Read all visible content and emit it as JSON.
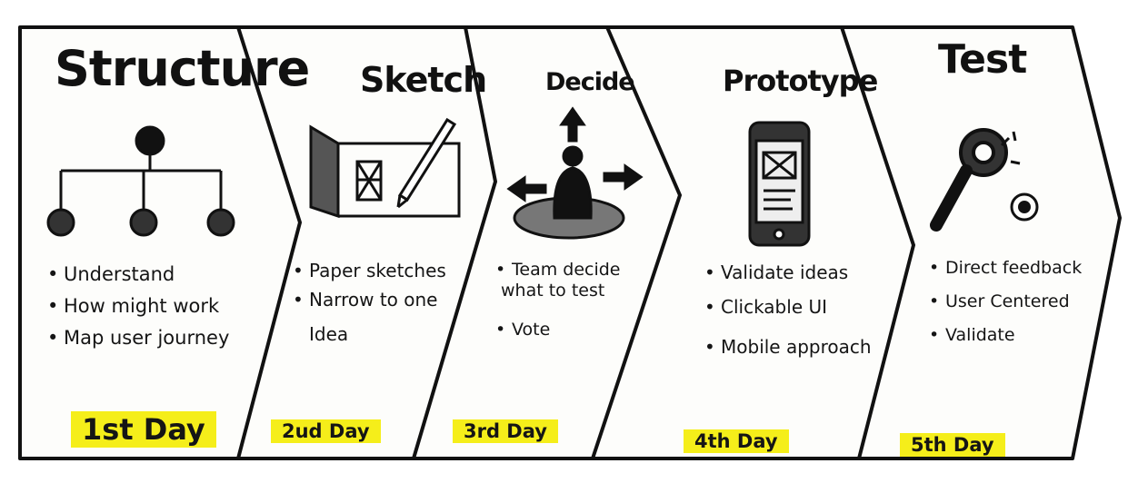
{
  "colors": {
    "ink": "#111111",
    "paper": "#fdfdfb",
    "highlight": "#f5ee1a"
  },
  "stages": [
    {
      "title": "Structure",
      "icon": "hierarchy-icon",
      "bullets": [
        "Understand",
        "How might work",
        "Map user journey"
      ],
      "day": "1st Day"
    },
    {
      "title": "Sketch",
      "icon": "paper-pencil-sketch-icon",
      "bullets": [
        "Paper sketches",
        "Narrow to one",
        "Idea"
      ],
      "day": "2ud Day"
    },
    {
      "title": "Decide",
      "icon": "person-arrows-icon",
      "bullets": [
        "Team decide",
        "what to test",
        "Vote"
      ],
      "day": "3rd Day"
    },
    {
      "title": "Prototype",
      "icon": "mobile-wireframe-icon",
      "bullets": [
        "Validate ideas",
        "Clickable UI",
        "Mobile approach"
      ],
      "day": "4th Day"
    },
    {
      "title": "Test",
      "icon": "magnifier-gear-icon",
      "bullets": [
        "Direct feedback",
        "User Centered",
        "Validate"
      ],
      "day": "5th Day"
    }
  ]
}
